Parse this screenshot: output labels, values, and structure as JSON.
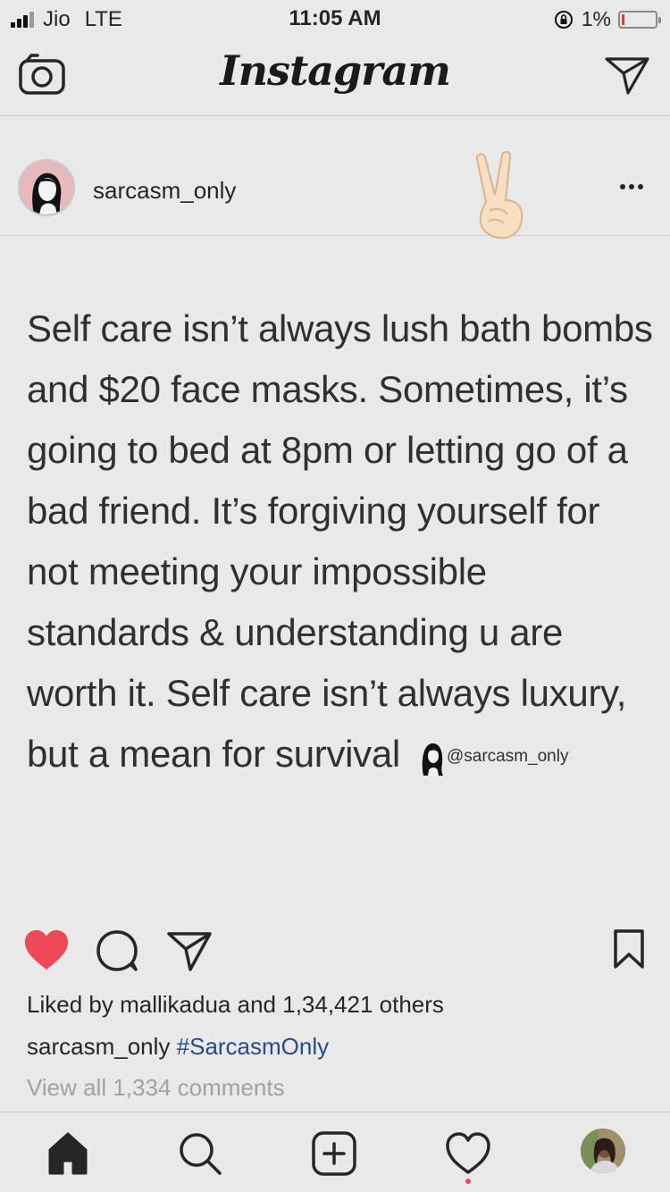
{
  "status_bar": {
    "carrier": "Jio",
    "network": "LTE",
    "time": "11:05 AM",
    "battery_percent": "1%",
    "battery_level": 0.01,
    "battery_color": "#e0403a"
  },
  "nav": {
    "title": "Instagram",
    "left_icon": "camera-icon",
    "right_icon": "direct-message-icon"
  },
  "post": {
    "username": "sarcasm_only",
    "emoji": "✌🏻",
    "text": "Self care isn’t always lush bath bombs and $20 face masks. Sometimes, it’s going to bed at 8pm or letting go of a bad friend. It’s forgiving yourself for not meeting your impossible standards & understanding u are worth it. Self care isn’t always luxury, but a mean for survival",
    "watermark": "@sarcasm_only",
    "liked": true,
    "like_color": "#ed4956",
    "likes_prefix": "Liked by",
    "liked_by": "mallikadua",
    "likes_and": "and",
    "likes_count": "1,34,421 others",
    "caption_user": "sarcasm_only",
    "caption_hashtag": "#SarcasmOnly",
    "view_comments": "View all 1,334 comments"
  },
  "tab_bar": {
    "items": [
      "home-icon",
      "search-icon",
      "add-post-icon",
      "activity-icon",
      "profile-avatar"
    ],
    "activity_notification": true
  }
}
